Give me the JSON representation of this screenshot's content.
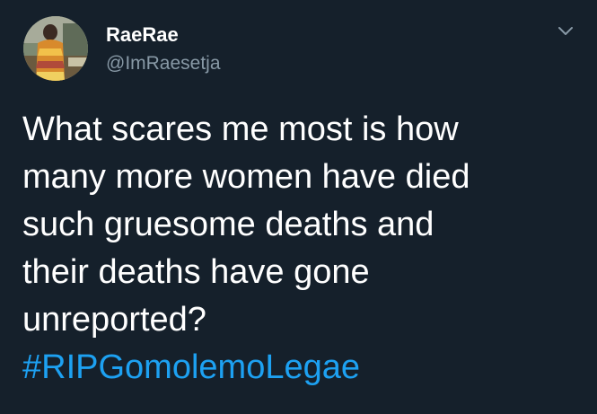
{
  "author": {
    "display_name": "RaeRae",
    "handle": "@ImRaesetja"
  },
  "tweet": {
    "lines": [
      "What scares me most is how",
      "many more women have died",
      "such gruesome deaths and",
      "their deaths have gone",
      "unreported?"
    ],
    "hashtag": "#RIPGomolemoLegae"
  },
  "icons": {
    "avatar": "profile-photo",
    "caret": "chevron-down-icon"
  },
  "colors": {
    "background": "#15202b",
    "text": "#ffffff",
    "secondary_text": "#8899a6",
    "link": "#1da1f2"
  }
}
